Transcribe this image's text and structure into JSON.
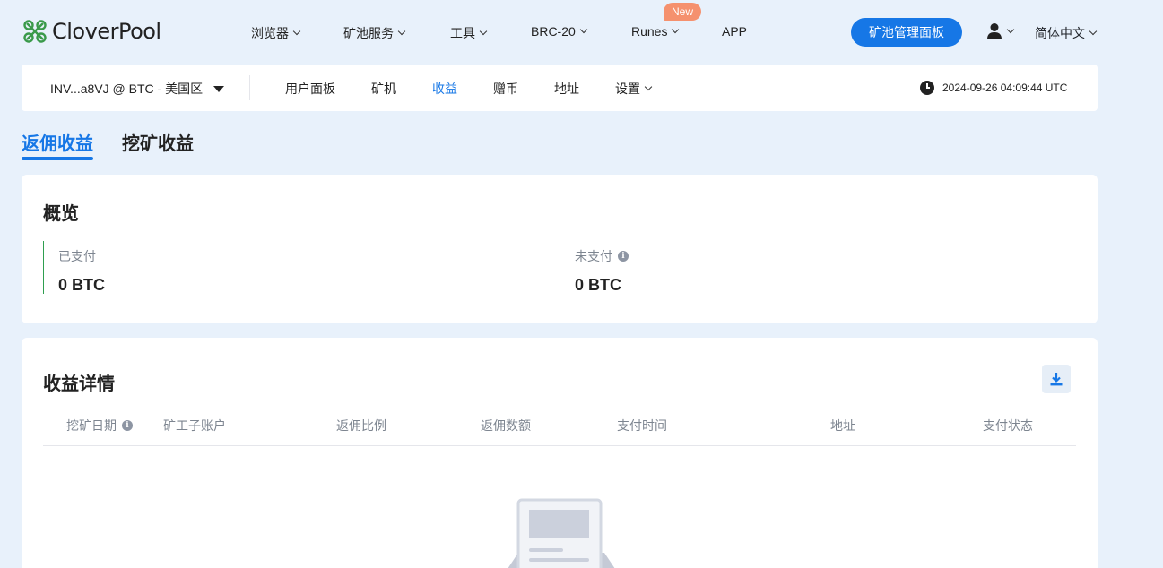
{
  "brand": {
    "name": "CloverPool"
  },
  "topnav": {
    "items": [
      {
        "label": "浏览器",
        "dropdown": true
      },
      {
        "label": "矿池服务",
        "dropdown": true
      },
      {
        "label": "工具",
        "dropdown": true
      },
      {
        "label": "BRC-20",
        "dropdown": true
      },
      {
        "label": "Runes",
        "dropdown": true,
        "badge": "New"
      },
      {
        "label": "APP",
        "dropdown": false
      }
    ],
    "dashboard_button": "矿池管理面板",
    "language": "简体中文"
  },
  "subnav": {
    "account": "INV...a8VJ @ BTC - 美国区",
    "items": [
      {
        "label": "用户面板"
      },
      {
        "label": "矿机"
      },
      {
        "label": "收益",
        "active": true
      },
      {
        "label": "赠币"
      },
      {
        "label": "地址"
      },
      {
        "label": "设置",
        "dropdown": true
      }
    ],
    "datetime": "2024-09-26 04:09:44 UTC"
  },
  "tabs": [
    {
      "label": "返佣收益",
      "active": true
    },
    {
      "label": "挖矿收益",
      "active": false
    }
  ],
  "overview": {
    "title": "概览",
    "paid": {
      "label": "已支付",
      "value": "0 BTC"
    },
    "unpaid": {
      "label": "未支付",
      "value": "0 BTC"
    }
  },
  "details": {
    "title": "收益详情",
    "columns": [
      "挖矿日期",
      "矿工子账户",
      "返佣比例",
      "返佣数额",
      "支付时间",
      "地址",
      "支付状态"
    ],
    "rows": []
  },
  "colors": {
    "accent": "#1677e6",
    "background": "#e8f1fb",
    "paid_bar": "#2e9e4f",
    "unpaid_bar": "#e8b255",
    "badge": "#f5916e"
  }
}
